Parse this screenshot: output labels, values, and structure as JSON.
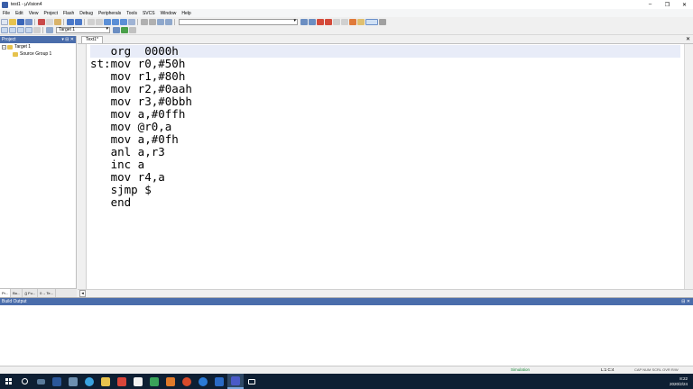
{
  "window": {
    "title": "test1 - µVision4"
  },
  "menu": [
    "File",
    "Edit",
    "View",
    "Project",
    "Flash",
    "Debug",
    "Peripherals",
    "Tools",
    "SVCS",
    "Window",
    "Help"
  ],
  "toolbar2": {
    "target_select": "Target 1"
  },
  "project_panel": {
    "title": "Project",
    "tree": [
      {
        "label": "Target 1",
        "expanded": true,
        "level": 0
      },
      {
        "label": "Source Group 1",
        "level": 1
      }
    ],
    "tabs": [
      "Pr...",
      "Bo...",
      "{} Fu...",
      "0→ Te..."
    ]
  },
  "editor": {
    "tab_label": "Text1*",
    "lines": [
      "   org  0000h",
      "st:mov r0,#50h",
      "   mov r1,#80h",
      "   mov r2,#0aah",
      "   mov r3,#0bbh",
      "   mov a,#0ffh",
      "   mov @r0,a",
      "   mov a,#0fh",
      "   anl a,r3",
      "   inc a",
      "   mov r4,a",
      "   sjmp $",
      "   end"
    ]
  },
  "build_output": {
    "title": "Build Output"
  },
  "statusbar": {
    "mode": "Simulation",
    "position": "L:1 C:4",
    "keys": "CAP  NUM  SCRL  OVR  R/W"
  },
  "taskbar": {
    "time": "8:22",
    "date": "2020/2/24"
  },
  "colors": {
    "panel_header": "#4a6dab",
    "taskbar": "#0e1f33",
    "simulation": "#1a8a3a"
  }
}
